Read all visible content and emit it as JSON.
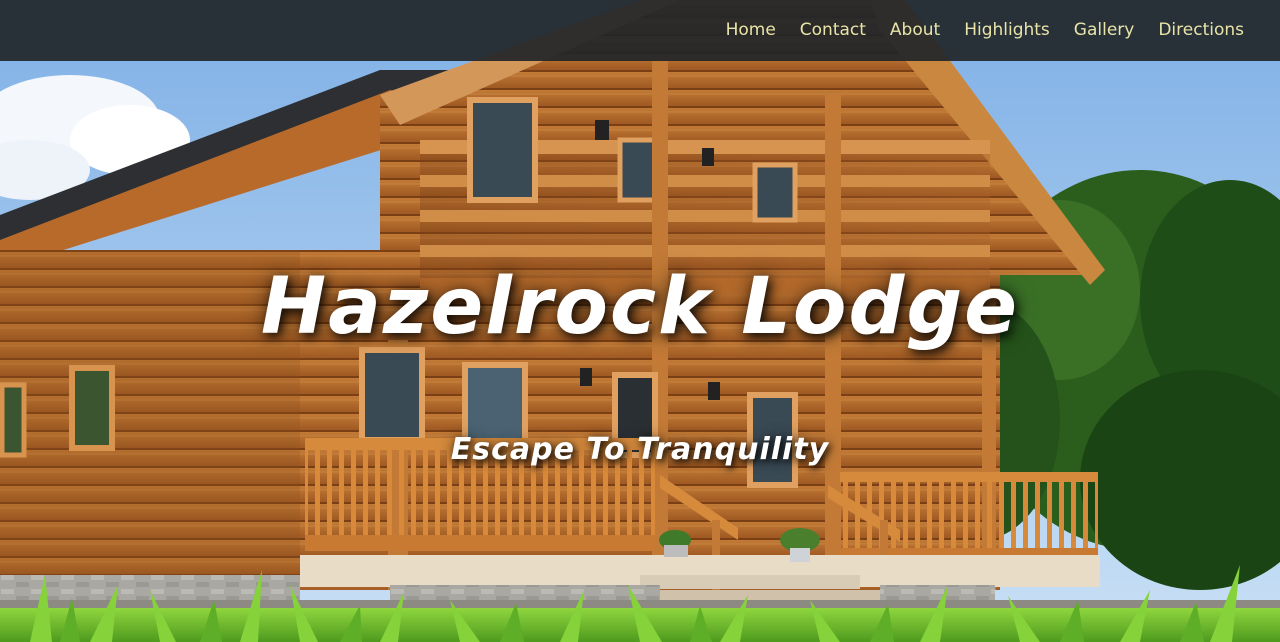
{
  "nav": {
    "items": [
      {
        "label": "Home"
      },
      {
        "label": "Contact"
      },
      {
        "label": "About"
      },
      {
        "label": "Highlights"
      },
      {
        "label": "Gallery"
      },
      {
        "label": "Directions"
      }
    ]
  },
  "hero": {
    "title": "Hazelrock Lodge",
    "subtitle": "Escape To Tranquility"
  },
  "colors": {
    "nav_background": "#212529",
    "nav_link": "#e8e4a8",
    "hero_text": "#ffffff",
    "sky": "#9fc4ea",
    "wood": "#b8692a",
    "foliage": "#1f4d17",
    "grass": "#7ccb3a"
  }
}
